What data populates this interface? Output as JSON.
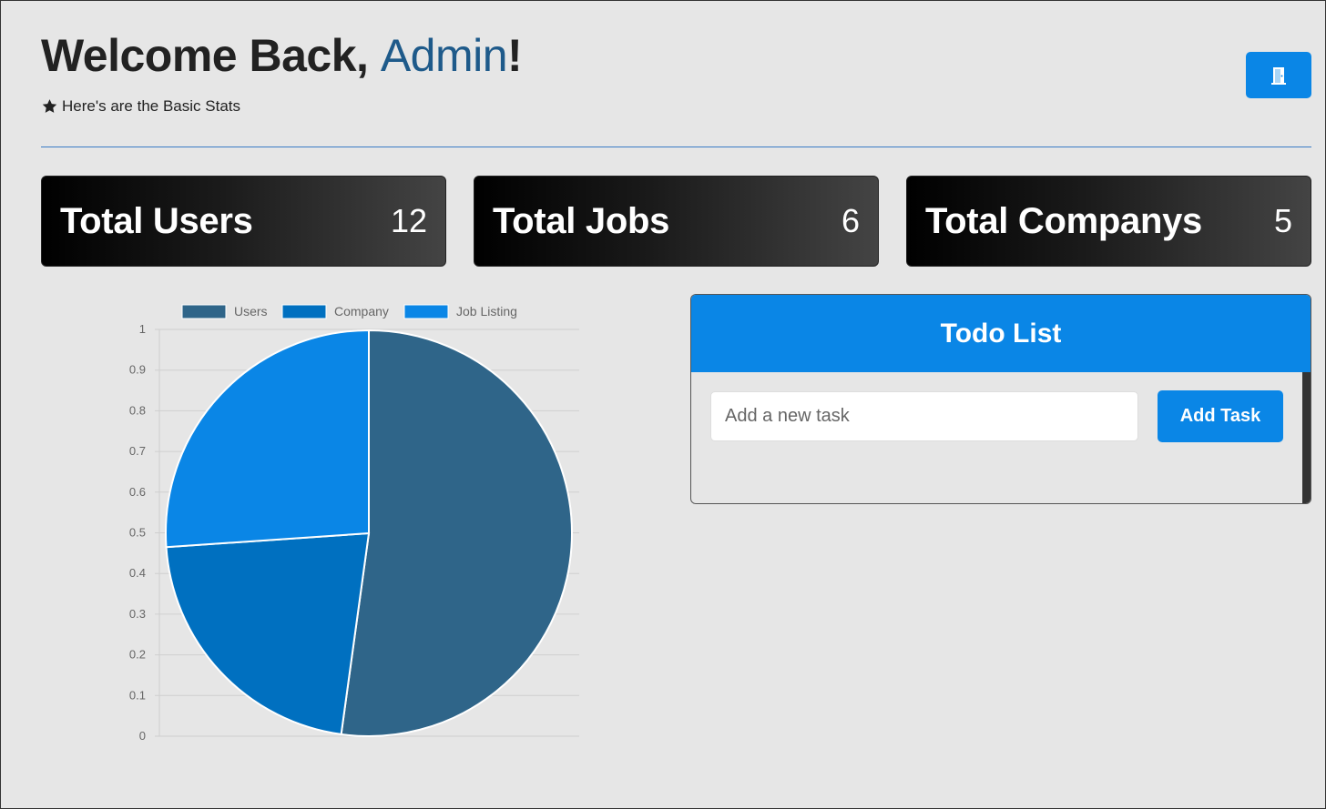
{
  "header": {
    "greeting": "Welcome Back, ",
    "name": "Admin",
    "exclaim": "!",
    "subtitle": "Here's are the Basic Stats"
  },
  "stats": [
    {
      "label": "Total Users",
      "value": "12"
    },
    {
      "label": "Total Jobs",
      "value": "6"
    },
    {
      "label": "Total Companys",
      "value": "5"
    }
  ],
  "todo": {
    "title": "Todo List",
    "placeholder": "Add a new task",
    "add_label": "Add Task"
  },
  "colors": {
    "accent": "#0a86e6",
    "users": "#2f6589",
    "company": "#0070c0",
    "job_listing": "#0a86e6"
  },
  "icons": {
    "subtitle": "star-icon",
    "logout": "door-icon"
  },
  "chart_data": {
    "type": "pie",
    "categories": [
      "Users",
      "Company",
      "Job Listing"
    ],
    "values": [
      12,
      5,
      6
    ],
    "colors": [
      "#2f6589",
      "#0070c0",
      "#0a86e6"
    ],
    "legend": "top",
    "yticks": [
      "0",
      "0.1",
      "0.2",
      "0.3",
      "0.4",
      "0.5",
      "0.6",
      "0.7",
      "0.8",
      "0.9",
      "1"
    ],
    "ylim": [
      0,
      1
    ],
    "grid": true
  }
}
